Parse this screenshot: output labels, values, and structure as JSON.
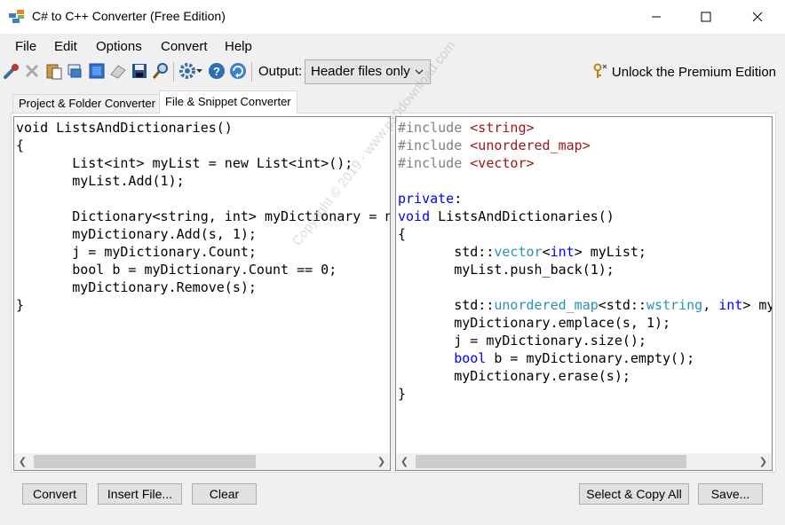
{
  "window": {
    "title": "C# to C++ Converter (Free Edition)"
  },
  "menu": {
    "file": "File",
    "edit": "Edit",
    "options": "Options",
    "convert": "Convert",
    "help": "Help"
  },
  "toolbar": {
    "output_label": "Output:",
    "output_value": "Header files only",
    "unlock": "Unlock the Premium Edition"
  },
  "tabs": [
    {
      "label": "Project & Folder Converter",
      "active": false
    },
    {
      "label": "File & Snippet Converter",
      "active": true
    }
  ],
  "watermark": "Copyright © 2019 - www.p30download.com",
  "buttons": {
    "convert": "Convert",
    "insert_file": "Insert File...",
    "clear": "Clear",
    "select_copy_all": "Select & Copy All",
    "save": "Save..."
  },
  "csharp_code": [
    "void ListsAndDictionaries()",
    "{",
    "\tList<int> myList = new List<int>();",
    "\tmyList.Add(1);",
    "",
    "\tDictionary<string, int> myDictionary = n",
    "\tmyDictionary.Add(s, 1);",
    "\tj = myDictionary.Count;",
    "\tbool b = myDictionary.Count == 0;",
    "\tmyDictionary.Remove(s);",
    "}"
  ],
  "cpp_code": [
    [
      {
        "t": "#include ",
        "c": "pp"
      },
      {
        "t": "<string>",
        "c": "str"
      }
    ],
    [
      {
        "t": "#include ",
        "c": "pp"
      },
      {
        "t": "<unordered_map>",
        "c": "str"
      }
    ],
    [
      {
        "t": "#include ",
        "c": "pp"
      },
      {
        "t": "<vector>",
        "c": "str"
      }
    ],
    [],
    [
      {
        "t": "private",
        "c": "kw"
      },
      {
        "t": ":",
        "c": ""
      }
    ],
    [
      {
        "t": "void",
        "c": "kw"
      },
      {
        "t": " ListsAndDictionaries()",
        "c": ""
      }
    ],
    [
      {
        "t": "{",
        "c": ""
      }
    ],
    [
      {
        "t": "\tstd::",
        "c": ""
      },
      {
        "t": "vector",
        "c": "type"
      },
      {
        "t": "<",
        "c": ""
      },
      {
        "t": "int",
        "c": "kw"
      },
      {
        "t": "> myList;",
        "c": ""
      }
    ],
    [
      {
        "t": "\tmyList.push_back(1);",
        "c": ""
      }
    ],
    [],
    [
      {
        "t": "\tstd::",
        "c": ""
      },
      {
        "t": "unordered_map",
        "c": "type"
      },
      {
        "t": "<std::",
        "c": ""
      },
      {
        "t": "wstring",
        "c": "type"
      },
      {
        "t": ", ",
        "c": ""
      },
      {
        "t": "int",
        "c": "kw"
      },
      {
        "t": "> my",
        "c": ""
      }
    ],
    [
      {
        "t": "\tmyDictionary.emplace(s, 1);",
        "c": ""
      }
    ],
    [
      {
        "t": "\tj = myDictionary.size();",
        "c": ""
      }
    ],
    [
      {
        "t": "\t",
        "c": ""
      },
      {
        "t": "bool",
        "c": "kw"
      },
      {
        "t": " b = myDictionary.empty();",
        "c": ""
      }
    ],
    [
      {
        "t": "\tmyDictionary.erase(s);",
        "c": ""
      }
    ],
    [
      {
        "t": "}",
        "c": ""
      }
    ]
  ]
}
